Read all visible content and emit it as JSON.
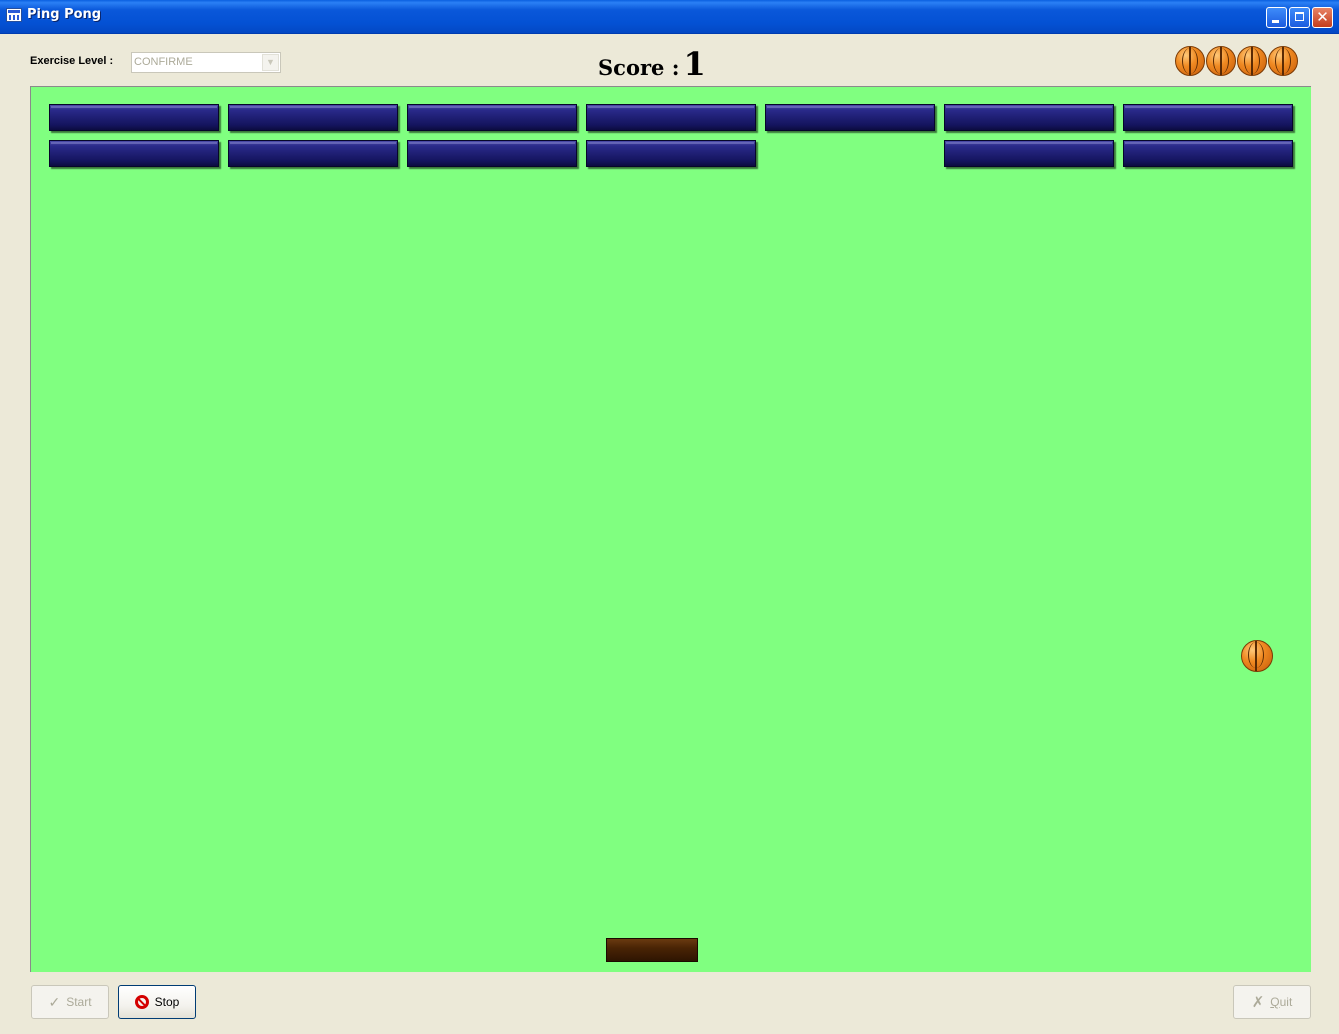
{
  "window": {
    "title": "Ping Pong",
    "icon": "app-grid-icon",
    "controls": [
      "minimize-icon",
      "restore-icon",
      "close-icon"
    ],
    "title_bar_color": "#0451d4"
  },
  "toolbar": {
    "level_label": "Exercise Level :",
    "level_value": "CONFIRME",
    "score_label": "Score :",
    "score_value": "1",
    "lives_remaining": 4,
    "life_icon": "basketball-icon"
  },
  "game": {
    "field_color": "#80ff80",
    "brick_color": "#1a1a6e",
    "paddle_color": "#4a2405",
    "ball_icon": "basketball-icon",
    "brick_rows": [
      [
        true,
        true,
        true,
        true,
        true,
        true,
        true
      ],
      [
        true,
        true,
        true,
        true,
        false,
        true,
        true
      ]
    ]
  },
  "buttons": {
    "start_label": "Start",
    "stop_label": "Stop",
    "quit_label": "Quit",
    "start_enabled": false,
    "stop_enabled": true,
    "quit_enabled": false
  }
}
